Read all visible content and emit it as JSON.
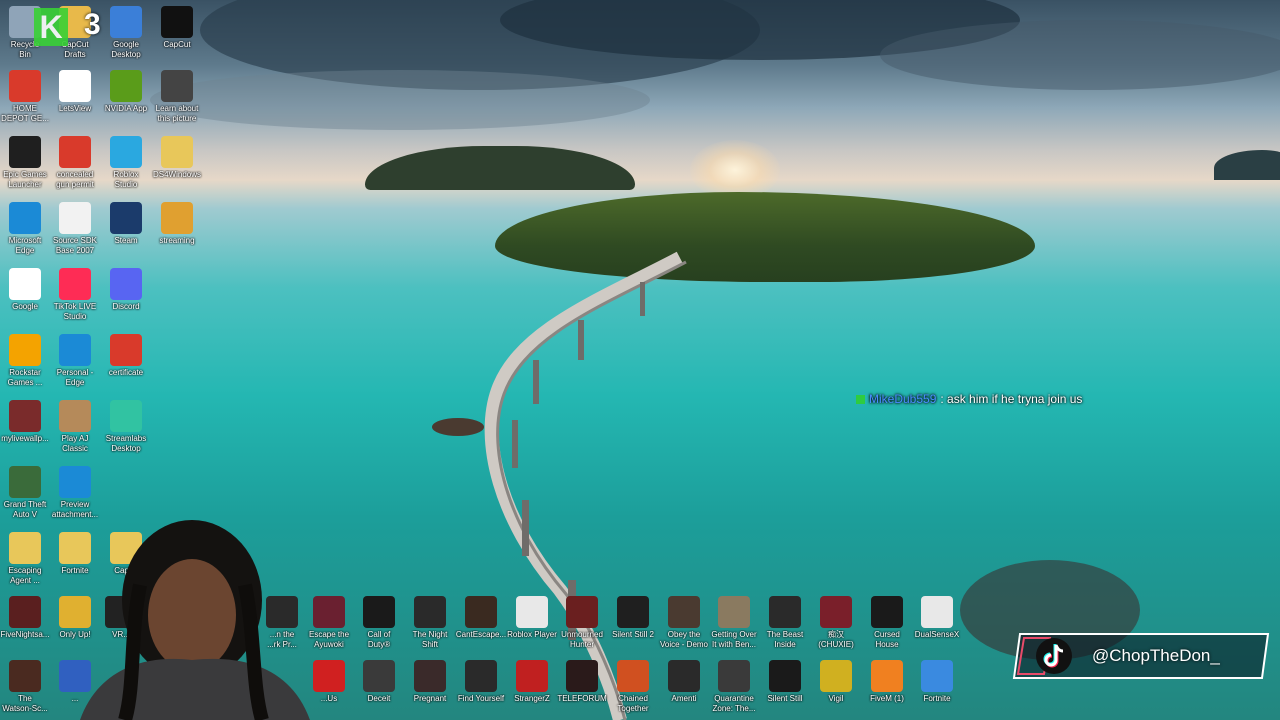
{
  "desktop": {
    "icons_top": [
      {
        "label": "Recycle\nBin",
        "icon": "recycle-bin-icon",
        "color": "#8fa4b8"
      },
      {
        "label": "CapCut\nDrafts",
        "icon": "folder-icon",
        "color": "#e8b94a"
      },
      {
        "label": "Google\nDesktop",
        "icon": "google-desktop-icon",
        "color": "#3b7fd8"
      },
      {
        "label": "CapCut",
        "icon": "capcut-icon",
        "color": "#111111"
      },
      {
        "label": "HOME\nDEPOT GE...",
        "icon": "pdf-icon",
        "color": "#d93a2b"
      },
      {
        "label": "LetsView",
        "icon": "letsview-icon",
        "color": "#ffffff"
      },
      {
        "label": "NVIDIA App",
        "icon": "nvidia-icon",
        "color": "#5a9c1a"
      },
      {
        "label": "Learn about\nthis picture",
        "icon": "camera-icon",
        "color": "#444444"
      },
      {
        "label": "Epic Games\nLauncher",
        "icon": "epic-games-icon",
        "color": "#1f1f1f"
      },
      {
        "label": "concealed\ngun permit",
        "icon": "pdf-icon",
        "color": "#d93a2b"
      },
      {
        "label": "Roblox\nStudio",
        "icon": "roblox-studio-icon",
        "color": "#2aa8e0"
      },
      {
        "label": "DS4Windows",
        "icon": "folder-icon",
        "color": "#e8c75a"
      },
      {
        "label": "Microsoft\nEdge",
        "icon": "edge-icon",
        "color": "#1b8ad6"
      },
      {
        "label": "Source SDK\nBase 2007",
        "icon": "document-icon",
        "color": "#f2f2f2"
      },
      {
        "label": "Steam",
        "icon": "steam-icon",
        "color": "#1b3b6b"
      },
      {
        "label": "streaming",
        "icon": "streaming-folder-icon",
        "color": "#e0a030"
      },
      {
        "label": "Google",
        "icon": "google-icon",
        "color": "#ffffff"
      },
      {
        "label": "TikTok LIVE\nStudio",
        "icon": "tiktok-live-icon",
        "color": "#fe2c55"
      },
      {
        "label": "Discord",
        "icon": "discord-icon",
        "color": "#5865f2"
      },
      {
        "label": "Rockstar\nGames ...",
        "icon": "rockstar-icon",
        "color": "#f4a300"
      },
      {
        "label": "Personal -\nEdge",
        "icon": "edge-icon",
        "color": "#1b8ad6"
      },
      {
        "label": "certificate",
        "icon": "pdf-icon",
        "color": "#d93a2b"
      },
      {
        "label": "mylivewallp...",
        "icon": "wallpaper-icon",
        "color": "#7a2b2b"
      },
      {
        "label": "Play AJ\nClassic",
        "icon": "animal-jam-icon",
        "color": "#b58a5a"
      },
      {
        "label": "Streamlabs\nDesktop",
        "icon": "streamlabs-icon",
        "color": "#31c3a2"
      },
      {
        "label": "Grand Theft\nAuto V",
        "icon": "gta-icon",
        "color": "#3a6b3a"
      },
      {
        "label": "Preview\nattachment...",
        "icon": "edge-icon",
        "color": "#1b8ad6"
      },
      {
        "label": "Escaping\nAgent ...",
        "icon": "folder-icon",
        "color": "#e8c75a"
      },
      {
        "label": "Fortnite",
        "icon": "folder-icon",
        "color": "#e8c75a"
      },
      {
        "label": "Capt...",
        "icon": "folder-icon",
        "color": "#e8c75a"
      }
    ],
    "icons_row1": [
      {
        "label": "FiveNightsa...",
        "icon": "game-icon",
        "color": "#5a1f1f"
      },
      {
        "label": "Only Up!",
        "icon": "only-up-icon",
        "color": "#e0b030"
      },
      {
        "label": "VR...",
        "icon": "vr-icon",
        "color": "#222222"
      },
      {
        "label": "...n the\n...rk Pr...",
        "icon": "game-icon",
        "color": "#2a2a2a"
      },
      {
        "label": "Escape the\nAyuwoki",
        "icon": "game-icon",
        "color": "#6a2030"
      },
      {
        "label": "Call of\nDuty®",
        "icon": "cod-icon",
        "color": "#1a1a1a"
      },
      {
        "label": "The Night\nShift",
        "icon": "game-icon",
        "color": "#2a2a2a"
      },
      {
        "label": "CantEscape...",
        "icon": "game-icon",
        "color": "#3a2a20"
      },
      {
        "label": "Roblox Player",
        "icon": "roblox-icon",
        "color": "#e8e8e8"
      },
      {
        "label": "Unmourned\nHunter",
        "icon": "game-icon",
        "color": "#6a1f1f"
      },
      {
        "label": "Silent Still 2",
        "icon": "game-icon",
        "color": "#1f1f1f"
      },
      {
        "label": "Obey the\nVoice - Demo",
        "icon": "game-icon",
        "color": "#4a3a30"
      },
      {
        "label": "Getting Over\nIt with Ben...",
        "icon": "hammer-icon",
        "color": "#8a7a60"
      },
      {
        "label": "The Beast\nInside",
        "icon": "game-icon",
        "color": "#2a2a2a"
      },
      {
        "label": "痴汉\n(CHUXIE)",
        "icon": "game-icon",
        "color": "#7a1f2a"
      },
      {
        "label": "Cursed\nHouse",
        "icon": "game-icon",
        "color": "#1a1a1a"
      },
      {
        "label": "DualSenseX",
        "icon": "controller-icon",
        "color": "#e8e8e8"
      }
    ],
    "icons_row2": [
      {
        "label": "The\nWatson-Sc...",
        "icon": "game-icon",
        "color": "#4a2a20"
      },
      {
        "label": "...",
        "icon": "game-icon",
        "color": "#3060c0"
      },
      {
        "label": "...Us",
        "icon": "among-us-icon",
        "color": "#d02020"
      },
      {
        "label": "Deceit",
        "icon": "rabbit-icon",
        "color": "#3a3a3a"
      },
      {
        "label": "Pregnant",
        "icon": "game-icon",
        "color": "#3a2a2a"
      },
      {
        "label": "Find Yourself",
        "icon": "game-icon",
        "color": "#2a2a2a"
      },
      {
        "label": "StrangerZ",
        "icon": "game-icon",
        "color": "#c02020"
      },
      {
        "label": "TELEFORUM",
        "icon": "game-icon",
        "color": "#2a1a1a"
      },
      {
        "label": "Chained\nTogether",
        "icon": "game-icon",
        "color": "#d05020"
      },
      {
        "label": "Amenti",
        "icon": "game-icon",
        "color": "#2a2a2a"
      },
      {
        "label": "Quarantine\nZone: The...",
        "icon": "game-icon",
        "color": "#3a3a3a"
      },
      {
        "label": "Silent Still",
        "icon": "game-icon",
        "color": "#1a1a1a"
      },
      {
        "label": "Vigil",
        "icon": "vigil-icon",
        "color": "#d0b020"
      },
      {
        "label": "FiveM (1)",
        "icon": "fivem-icon",
        "color": "#f08020"
      },
      {
        "label": "Fortnite",
        "icon": "fortnite-icon",
        "color": "#3a8ae0"
      }
    ]
  },
  "overlay": {
    "score": "3",
    "k_logo": "K",
    "chat_user": "MikeDub559",
    "chat_message": ": ask him if he tryna join us",
    "tiktok_handle": "@ChopTheDon_"
  }
}
